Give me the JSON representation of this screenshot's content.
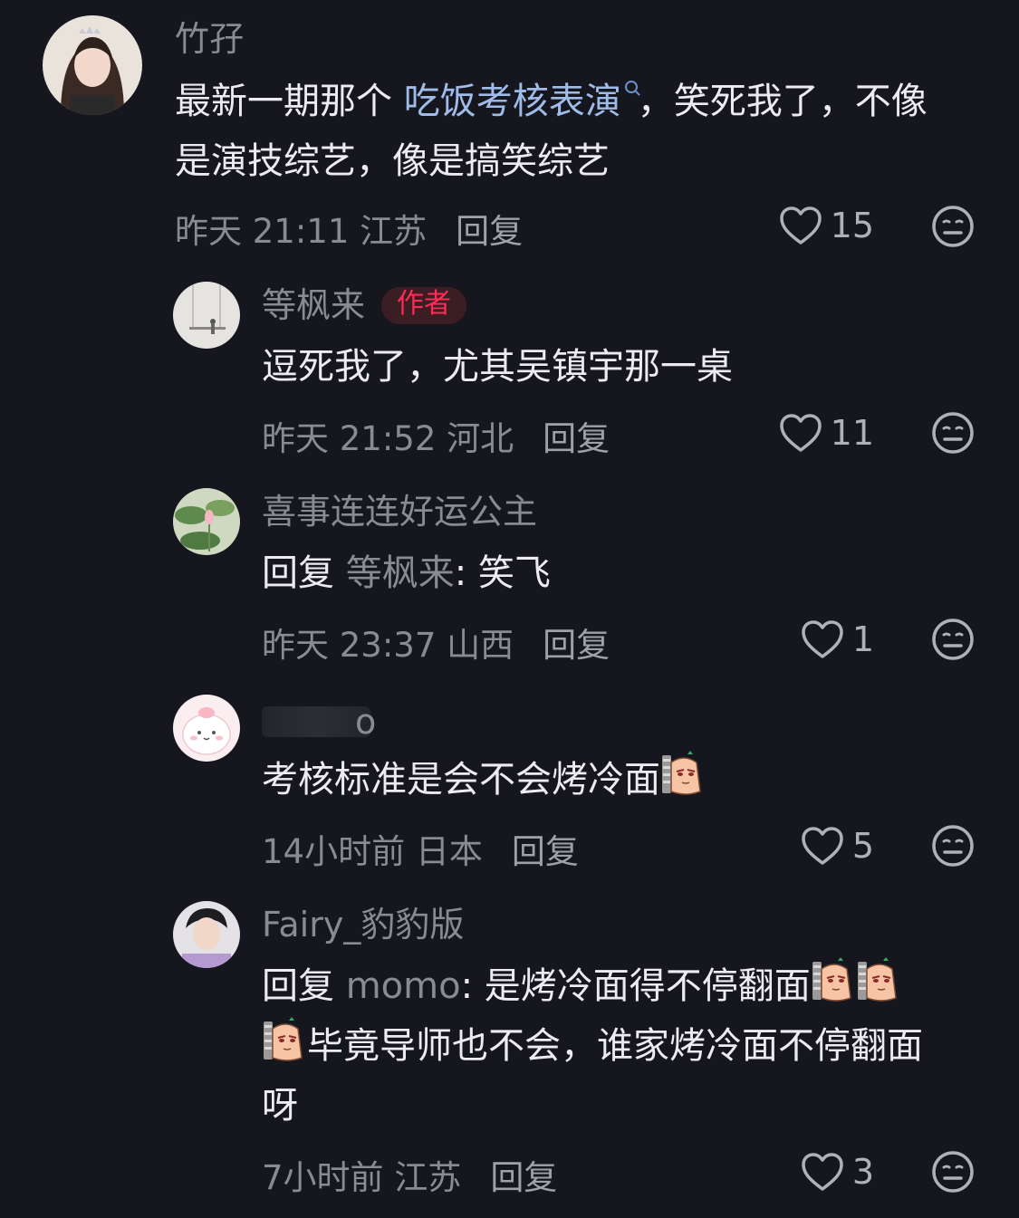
{
  "comments": [
    {
      "username": "竹孖",
      "content": {
        "before": "最新一期那个 ",
        "link": "吃饭考核表演",
        "after": "，笑死我了，不像是演技综艺，像是搞笑综艺"
      },
      "time": "昨天 21:11",
      "location": "江苏",
      "reply_label": "回复",
      "likes": "15"
    },
    {
      "username": "等枫来",
      "badge": "作者",
      "content": "逗死我了，尤其吴镇宇那一桌",
      "time": "昨天 21:52",
      "location": "河北",
      "reply_label": "回复",
      "likes": "11"
    },
    {
      "username": "喜事连连好运公主",
      "content": {
        "prefix": "回复 ",
        "target": "等枫来",
        "text": ": 笑飞"
      },
      "time": "昨天 23:37",
      "location": "山西",
      "reply_label": "回复",
      "likes": "1"
    },
    {
      "username_visible": "o",
      "content": "考核标准是会不会烤冷面",
      "emoji_name": "sly-sausage-emoji",
      "time": "14小时前",
      "location": "日本",
      "reply_label": "回复",
      "likes": "5"
    },
    {
      "username": "Fairy_豹豹版",
      "content": {
        "prefix": "回复 ",
        "target": "momo",
        "line1": ": 是烤冷面得不停翻面",
        "line2": "毕竟导师也不会，谁家烤冷面不停翻面",
        "line3": "呀"
      },
      "time": "7小时前",
      "location": "江苏",
      "reply_label": "回复",
      "likes": "3"
    }
  ],
  "colors": {
    "background": "#16161e",
    "muted": "#8a8a93",
    "text": "#ececf0",
    "link": "#9fbbe8",
    "author_badge": "#fe2c55"
  }
}
